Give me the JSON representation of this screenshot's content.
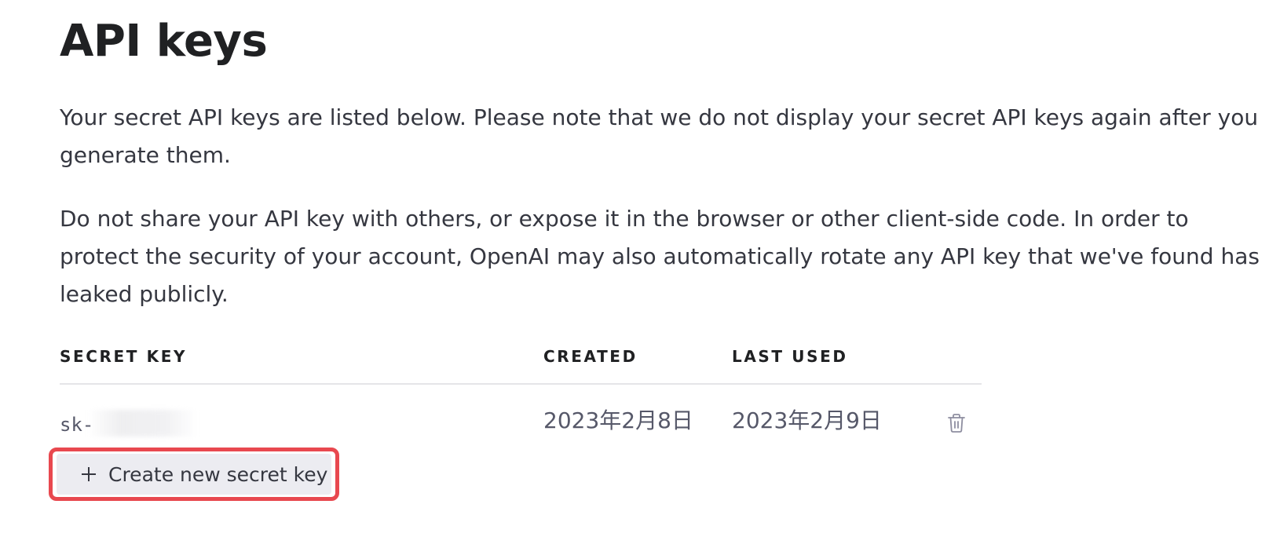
{
  "page": {
    "title": "API keys",
    "description_1": "Your secret API keys are listed below. Please note that we do not display your secret API keys again after you generate them.",
    "description_2": "Do not share your API key with others, or expose it in the browser or other client-side code. In order to protect the security of your account, OpenAI may also automatically rotate any API key that we've found has leaked publicly."
  },
  "table": {
    "headers": {
      "secret_key": "SECRET KEY",
      "created": "CREATED",
      "last_used": "LAST USED"
    },
    "rows": [
      {
        "secret_key": "sk-",
        "created": "2023年2月8日",
        "last_used": "2023年2月9日",
        "delete_icon": "trash-icon"
      }
    ]
  },
  "actions": {
    "create_label": "Create new secret key",
    "create_icon": "plus-icon"
  },
  "colors": {
    "highlight_border": "#e8484f",
    "button_bg": "#ececf1",
    "title": "#202123",
    "body_text": "#353740",
    "muted_text": "#565869",
    "divider": "#e5e5e8"
  }
}
